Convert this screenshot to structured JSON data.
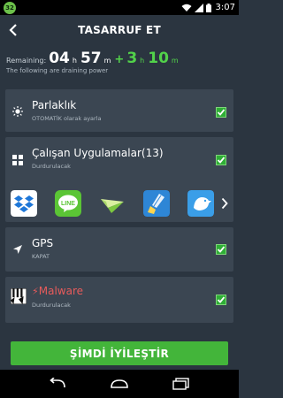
{
  "status_bar": {
    "battery_badge": "32",
    "time": "3:07"
  },
  "header": {
    "title": "TASARRUF ET"
  },
  "remaining": {
    "label": "Remaining:",
    "current_hours": "04",
    "hours_unit": "h",
    "current_minutes": "57",
    "minutes_unit": "m",
    "plus": "+",
    "gain_hours": "3",
    "gain_hours_unit": "h",
    "gain_minutes": "10",
    "gain_minutes_unit": "m",
    "draining_text": "The following are draining power"
  },
  "items": [
    {
      "title": "Parlaklık",
      "subtitle": "OTOMATİK olarak ayarla",
      "checked": true,
      "icon": "brightness-icon"
    },
    {
      "title": "Çalışan Uygulamalar(13)",
      "subtitle": "Durdurulacak",
      "checked": true,
      "icon": "apps-grid-icon",
      "apps": [
        "dropbox-icon",
        "line-icon",
        "paper-plane-icon",
        "cleaner-icon",
        "bird-icon"
      ]
    },
    {
      "title": "GPS",
      "subtitle": "KAPAT",
      "checked": true,
      "icon": "location-arrow-icon"
    },
    {
      "title": "Malware",
      "subtitle": "Durdurulacak",
      "checked": true,
      "icon": "piano-icon",
      "warning": true
    }
  ],
  "fix_button": {
    "label": "ŞİMDİ İYİLEŞTİR"
  },
  "colors": {
    "accent_green": "#43b53a",
    "malware_red": "#e85b5b",
    "card_bg": "#3b4652",
    "page_bg": "#2b3540"
  }
}
